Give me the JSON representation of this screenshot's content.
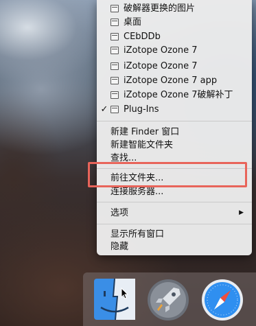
{
  "menu": {
    "folders": [
      {
        "label": "破解器更换的图片",
        "checked": false
      },
      {
        "label": "桌面",
        "checked": false
      },
      {
        "label": "CEbDDb",
        "checked": false
      },
      {
        "label": "iZotope Ozone 7",
        "checked": false
      },
      {
        "label": "iZotope Ozone 7",
        "checked": false
      },
      {
        "label": "iZotope Ozone 7 app",
        "checked": false
      },
      {
        "label": "iZotope Ozone 7破解补丁",
        "checked": false
      },
      {
        "label": "Plug-Ins",
        "checked": true
      }
    ],
    "check_mark": "✓",
    "new_finder_window": "新建 Finder 窗口",
    "new_smart_folder": "新建智能文件夹",
    "find": "查找...",
    "go_to_folder": "前往文件夹...",
    "connect_to_server": "连接服务器...",
    "options": "选项",
    "options_arrow": "▶",
    "show_all_windows": "显示所有窗口",
    "hide": "隐藏"
  },
  "highlight_color": "#e8645a",
  "dock": {
    "icons": [
      "finder-icon",
      "launchpad-icon",
      "safari-icon"
    ]
  }
}
